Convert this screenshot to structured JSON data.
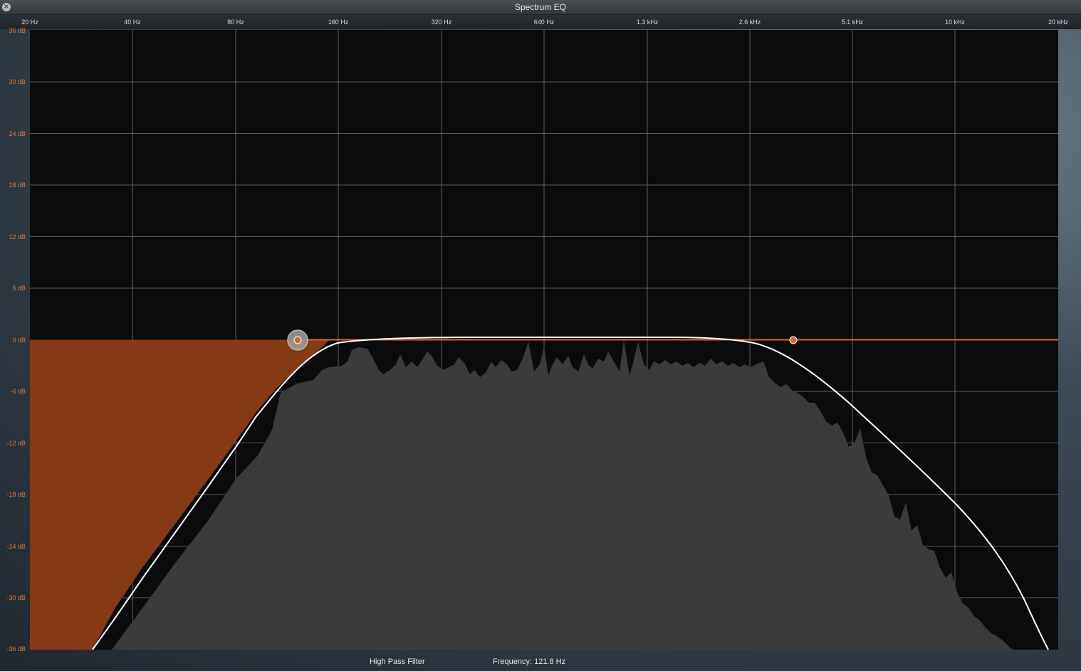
{
  "window": {
    "title": "Spectrum EQ",
    "close_icon": "close-icon"
  },
  "freq_axis": [
    "20 Hz",
    "40 Hz",
    "80 Hz",
    "160 Hz",
    "320 Hz",
    "640 Hz",
    "1.3 kHz",
    "2.6 kHz",
    "5.1 kHz",
    "10 kHz",
    "20 kHz"
  ],
  "db_axis": [
    "36 dB",
    "30 dB",
    "24 dB",
    "18 dB",
    "12 dB",
    "6 dB",
    "0 dB",
    "-6 dB",
    "-12 dB",
    "-18 dB",
    "-24 dB",
    "-30 dB",
    "-36 dB"
  ],
  "footer": {
    "filter_type": "High Pass Filter",
    "frequency": "Frequency: 121.8 Hz"
  },
  "colors": {
    "accent": "#e0642a",
    "cut_region": "#853a15",
    "spectrum_fill": "#3a3b3d",
    "curve": "#ffffff"
  },
  "eq": {
    "high_pass": {
      "freq_hz": 121.8,
      "gain_db": 0
    },
    "low_pass": {
      "freq_hz": 3700,
      "gain_db": 0
    }
  }
}
